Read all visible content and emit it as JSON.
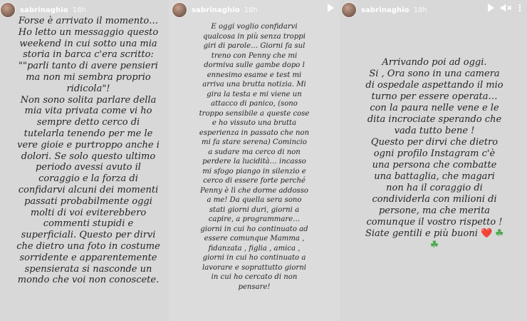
{
  "stories": [
    {
      "username": "sabrinaghio",
      "time": "18h",
      "show_pause": false,
      "show_volume": false,
      "text": "Forse è arrivato il momento…\nHo letto un messaggio questo\nweekend in cui sotto una mia\nstoria in barca c'era scritto:\n\"\"parli tanto di avere pensieri\nma non mi sembra proprio\nridicola\"!\nNon sono solita parlare della\nmia vita privata come vi ho\nsempre detto cerco di\ntutelarla tenendo per me le\nvere gioie e purtroppo anche i\ndolori. Se solo questo ultimo\nperiodo avessi avuto il\ncoraggio e la forza di\nconfidarvi alcuni dei momenti\npassati probabilmente oggi\nmolti di voi eviterebbero\ncommenti stupidi e\nsuperficiali. Questo per dirvi\nche dietro una foto in costume\nsorridente e apparentemente\nspensierata si nasconde un\nmondo che voi non conoscete."
    },
    {
      "username": "sabrinaghio",
      "time": "18h",
      "show_pause": true,
      "show_volume": false,
      "text": "E oggi voglio confidarvi\nqualcosa in più senza troppi\ngiri di parole… Giorni fa sul\ntreno con Penny che mi\ndormiva sulle gambe dopo l\nennesimo esame e test mi\narriva una brutta notizia. Mi\ngira la testa e mi viene un\nattacco di panico, (sono\ntroppo sensibile a queste cose\ne ho vissuto una brutta\nesperienza in passato che non\nmi fa stare serena) Comincio\na sudare ma cerco di non\nperdere la lucidità… incasso\nmi sfogo piango in silenzio e\ncerco di essere forte perché\nPenny è lì che dorme addosso\na me! Da quella sera sono\nstati giorni duri, giorni a\ncapire, a programmare…\ngiorni in cui ho continuato ad\nessere comunque Mamma ,\nfidanzata , figlia , amica ,\ngiorni in cui ho continuato a\nlavorare e soprattutto giorni\nin cui ho cercato di non\npensare!"
    },
    {
      "username": "sabrinaghio",
      "time": "18h",
      "show_pause": true,
      "show_volume": true,
      "text": "Arrivando poi ad oggi.\nSi , Ora sono in una camera\ndi ospedale aspettando il mio\nturno per essere operata…\ncon la paura nelle vene e le\ndita incrociate sperando che\nvada tutto bene !\nQuesto per dirvi che dietro\nogni profilo Instagram c'è\nuna persona che combatte\nuna battaglia, che magari\nnon ha il coraggio di\ncondividerla con milioni di\npersone, ma che merita\ncomunque il vostro rispetto !\nSiate gentili e più buoni",
      "emoji_heart": "❤️",
      "emoji_clover": "☘",
      "emoji_clover_2": "☘"
    }
  ],
  "icons": {
    "pause": "pause-icon",
    "volume": "volume-muted-icon"
  },
  "colors": {
    "story_bg": "#d8d8d8",
    "text": "#242424",
    "header_text": "#ffffff",
    "heart": "#e0245e",
    "clover": "#4aa84a"
  }
}
